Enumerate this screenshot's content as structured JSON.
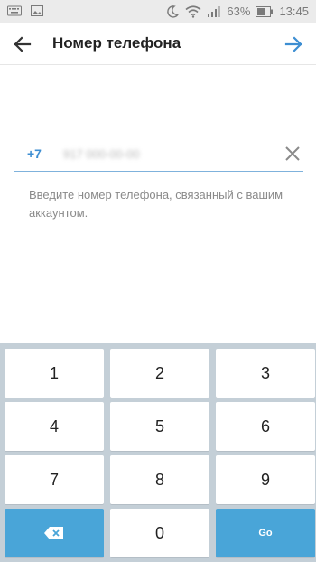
{
  "status_bar": {
    "battery": "63%",
    "time": "13:45"
  },
  "header": {
    "title": "Номер телефона",
    "back_icon": "arrow-left-icon",
    "next_icon": "arrow-right-icon"
  },
  "phone": {
    "country_code": "+7",
    "number": "917 000-00-00",
    "hint": "Введите номер телефона, связанный с вашим аккаунтом."
  },
  "keypad": {
    "keys": [
      "1",
      "2",
      "3",
      "4",
      "5",
      "6",
      "7",
      "8",
      "9"
    ],
    "zero": "0",
    "go_label": "Go",
    "backspace_icon": "backspace-icon"
  },
  "colors": {
    "accent": "#3d8ed2",
    "keypad_bg": "#c4cfd7",
    "action_key": "#49a5d8"
  }
}
